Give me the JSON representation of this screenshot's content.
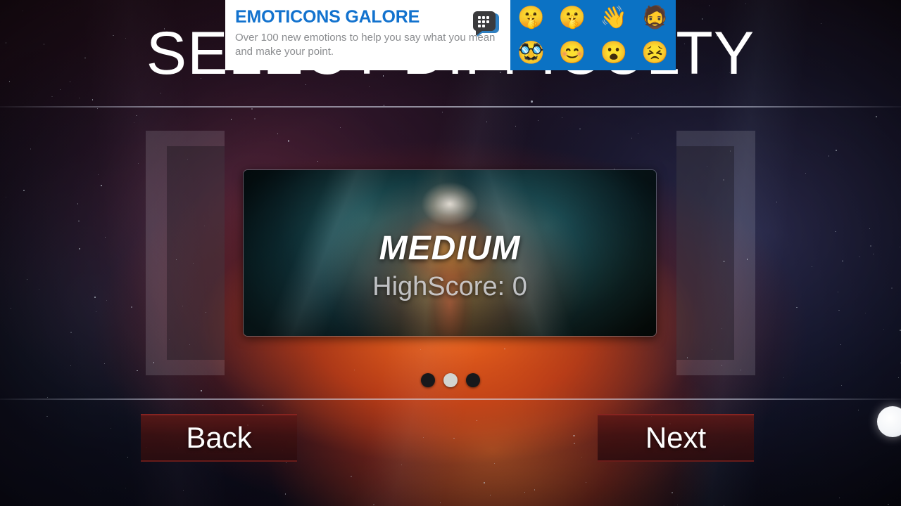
{
  "page_title": "SELECT DIFFICULTY",
  "card": {
    "difficulty": "MEDIUM",
    "highscore": "HighScore: 0"
  },
  "pagination": {
    "dots": [
      {
        "name": "dot-1",
        "active": false
      },
      {
        "name": "dot-2",
        "active": true
      },
      {
        "name": "dot-3",
        "active": false
      }
    ],
    "active_index": 1,
    "total": 3
  },
  "buttons": {
    "back": "Back",
    "next": "Next"
  },
  "ad": {
    "headline": "EMOTICONS GALORE",
    "subtext": "Over 100 new emotions to help you say what you mean and make your point.",
    "logo_name": "bbm-logo",
    "panel_color": "#0b72c4",
    "headline_color": "#1272ce",
    "emojis": [
      "🤫",
      "🤫",
      "👋",
      "🧔",
      "🥸",
      "😊",
      "😮",
      "😣"
    ]
  },
  "colors": {
    "title_text": "#ffffff",
    "button_fill": "#3e1010",
    "button_border": "#962824",
    "dot_active": "#d2d4d0",
    "dot_inactive": "#17181b",
    "divider": "#d7dceb"
  },
  "indicator": {
    "name": "touch-indicator"
  }
}
